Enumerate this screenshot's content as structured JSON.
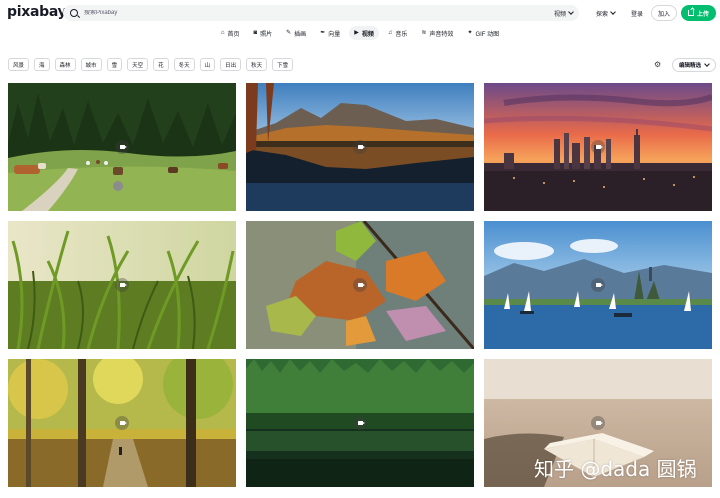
{
  "logo": "pixabay",
  "search": {
    "placeholder": "搜索Pixabay",
    "type_label": "视频"
  },
  "nav": {
    "explore": "探索",
    "login": "登录",
    "join": "加入",
    "upload": "上传"
  },
  "categories": [
    {
      "label": "首页",
      "icon": "home-icon"
    },
    {
      "label": "照片",
      "icon": "camera-icon"
    },
    {
      "label": "插画",
      "icon": "brush-icon"
    },
    {
      "label": "向量",
      "icon": "pen-nib-icon"
    },
    {
      "label": "视频",
      "icon": "video-icon",
      "active": true
    },
    {
      "label": "音乐",
      "icon": "music-icon"
    },
    {
      "label": "声音特效",
      "icon": "sound-wave-icon"
    },
    {
      "label": "GIF 动图",
      "icon": "gif-icon"
    }
  ],
  "tags": [
    "风景",
    "海",
    "森林",
    "城市",
    "雪",
    "天空",
    "花",
    "冬天",
    "山",
    "日出",
    "秋天",
    "下雪"
  ],
  "sort_label": "编辑精选",
  "videos": [
    {
      "name": "cows-meadow-forest"
    },
    {
      "name": "mountain-lake-reflection"
    },
    {
      "name": "city-skyline-sunset"
    },
    {
      "name": "grass-closeup-sunlight"
    },
    {
      "name": "autumn-leaves-branch"
    },
    {
      "name": "lake-sailboats-castle"
    },
    {
      "name": "autumn-forest-path"
    },
    {
      "name": "forest-lake-reflection"
    },
    {
      "name": "open-book-on-sand"
    }
  ],
  "watermark": "知乎 @dada 圆锅"
}
